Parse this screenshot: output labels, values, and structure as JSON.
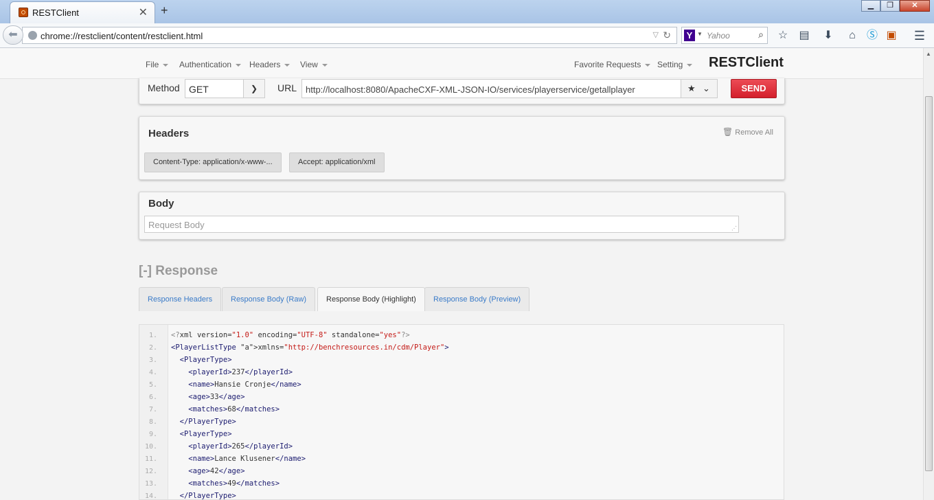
{
  "browser": {
    "tab_title": "RESTClient",
    "url": "chrome://restclient/content/restclient.html",
    "search_engine": "Yahoo",
    "search_placeholder": "Yahoo"
  },
  "app": {
    "brand": "RESTClient",
    "menu_left": [
      "File",
      "Authentication",
      "Headers",
      "View"
    ],
    "menu_right": [
      "Favorite Requests",
      "Setting"
    ]
  },
  "request": {
    "method_label": "Method",
    "method": "GET",
    "url_label": "URL",
    "url": "http://localhost:8080/ApacheCXF-XML-JSON-IO/services/playerservice/getallplayer",
    "send_label": "SEND"
  },
  "headers": {
    "title": "Headers",
    "remove_all": "Remove All",
    "items": [
      "Content-Type: application/x-www-...",
      "Accept: application/xml"
    ]
  },
  "body": {
    "title": "Body",
    "placeholder": "Request Body"
  },
  "response": {
    "title": "Response",
    "toggle": "[-]",
    "tabs": [
      "Response Headers",
      "Response Body (Raw)",
      "Response Body (Highlight)",
      "Response Body (Preview)"
    ],
    "active_tab": "Response Body (Highlight)",
    "line_numbers": [
      "1.",
      "2.",
      "3.",
      "4.",
      "5.",
      "6.",
      "7.",
      "8.",
      "9.",
      "10.",
      "11.",
      "12.",
      "13.",
      "14."
    ],
    "lines": [
      "<?xml version=\"1.0\" encoding=\"UTF-8\" standalone=\"yes\"?>",
      "<PlayerListType xmlns=\"http://benchresources.in/cdm/Player\">",
      "  <PlayerType>",
      "    <playerId>237</playerId>",
      "    <name>Hansie Cronje</name>",
      "    <age>33</age>",
      "    <matches>68</matches>",
      "  </PlayerType>",
      "  <PlayerType>",
      "    <playerId>265</playerId>",
      "    <name>Lance Klusener</name>",
      "    <age>42</age>",
      "    <matches>49</matches>",
      "  </PlayerType>"
    ]
  }
}
